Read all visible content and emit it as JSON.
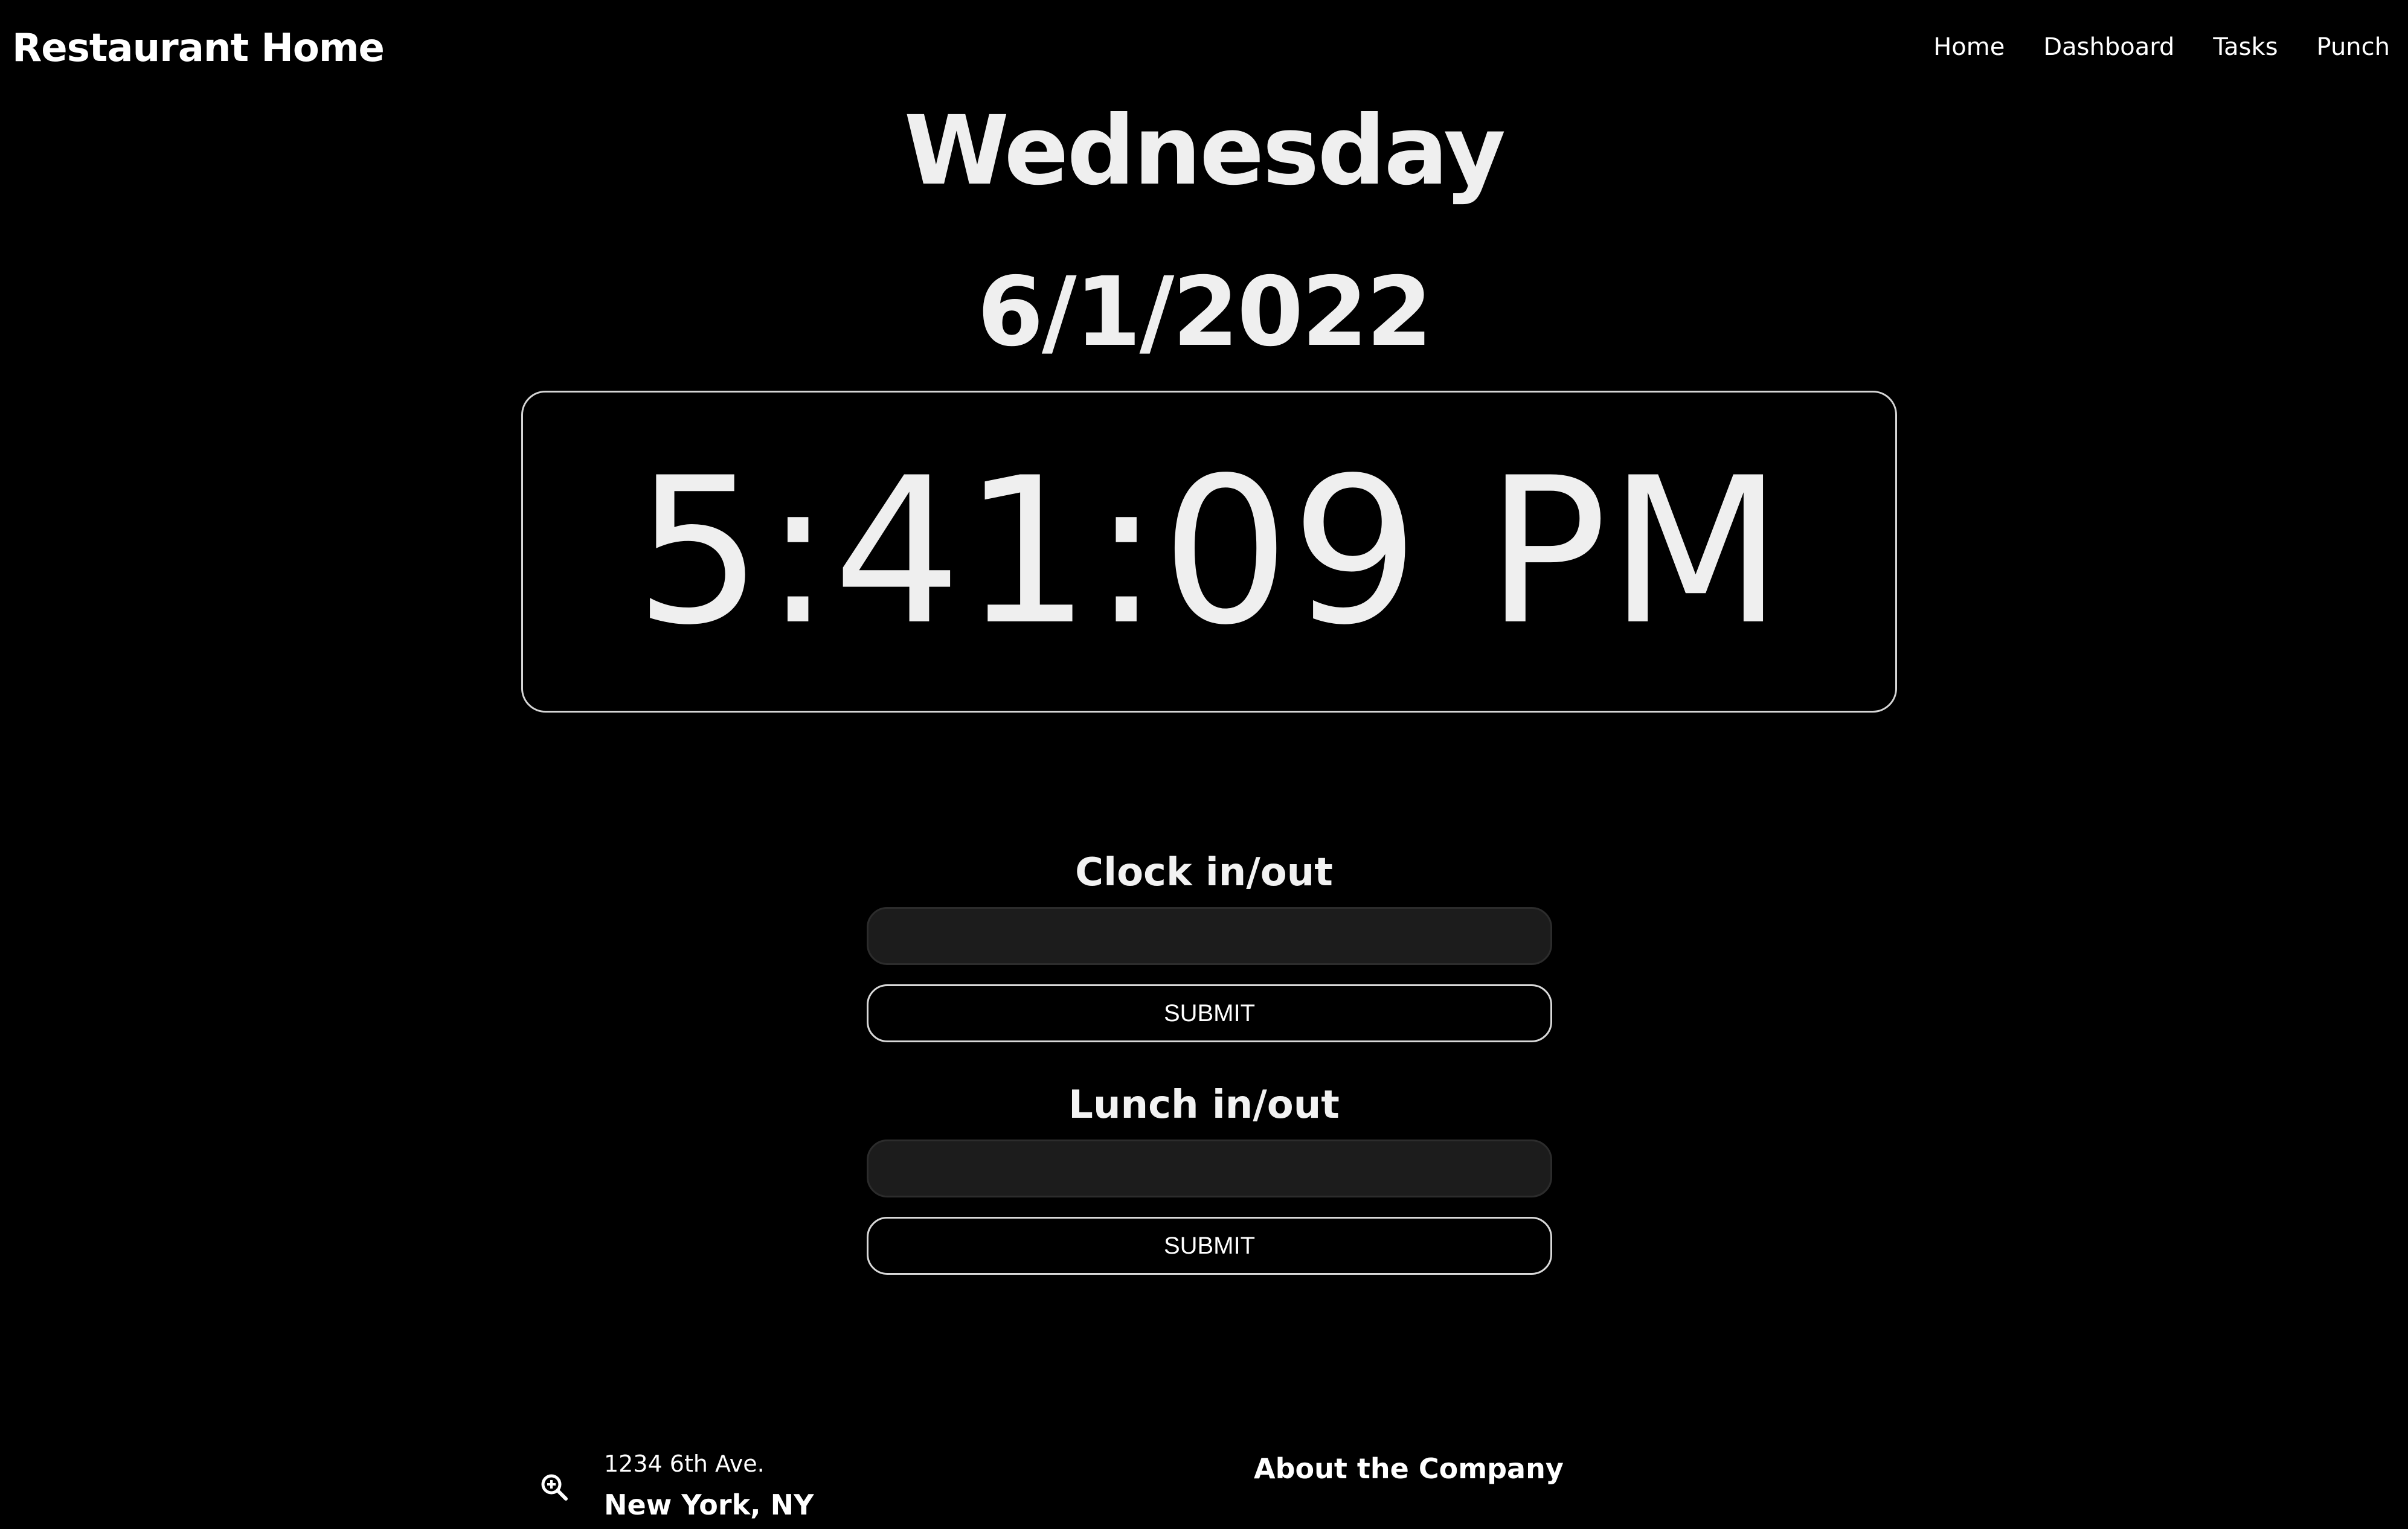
{
  "header": {
    "brand": "Restaurant Home",
    "nav": [
      "Home",
      "Dashboard",
      "Tasks",
      "Punch"
    ]
  },
  "display": {
    "day": "Wednesday",
    "date": "6/1/2022",
    "time": "5:41:09 PM"
  },
  "forms": {
    "clock": {
      "title": "Clock in/out",
      "input_value": "",
      "button": "SUBMIT"
    },
    "lunch": {
      "title": "Lunch in/out",
      "input_value": "",
      "button": "SUBMIT"
    }
  },
  "footer": {
    "address_line1": "1234 6th Ave.",
    "address_line2": "New York, NY",
    "about_heading": "About the Company",
    "location_icon": "zoom-in-icon"
  },
  "colors": {
    "background": "#000000",
    "text": "#efefef",
    "input_bg": "#1c1c1c",
    "border": "#d9d9d9"
  }
}
